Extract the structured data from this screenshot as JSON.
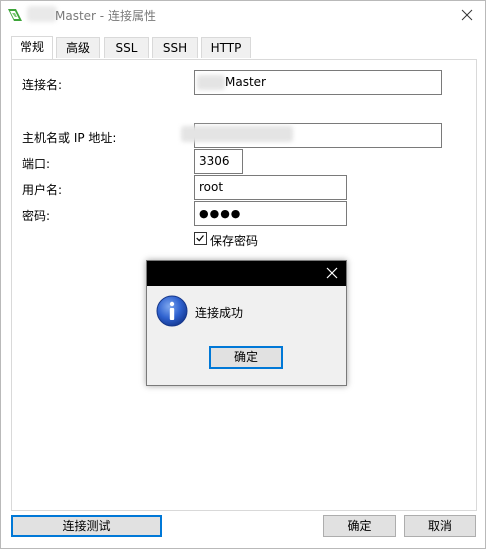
{
  "window": {
    "title": "Master - 连接属性",
    "close_glyph": "✕"
  },
  "tabs": [
    {
      "label": "常规",
      "active": true
    },
    {
      "label": "高级",
      "active": false
    },
    {
      "label": "SSL",
      "active": false
    },
    {
      "label": "SSH",
      "active": false
    },
    {
      "label": "HTTP",
      "active": false
    }
  ],
  "form": {
    "connection_name_label": "连接名:",
    "connection_name_value": "Master",
    "host_label": "主机名或 IP 地址:",
    "host_value": "",
    "port_label": "端口:",
    "port_value": "3306",
    "username_label": "用户名:",
    "username_value": "root",
    "password_label": "密码:",
    "password_value": "●●●●",
    "save_password_label": "保存密码",
    "save_password_checked": true
  },
  "footer": {
    "test_connection_label": "连接测试",
    "ok_label": "确定",
    "cancel_label": "取消"
  },
  "modal": {
    "message": "连接成功",
    "ok_label": "确定",
    "icon": "info-icon",
    "close_glyph": "✕"
  },
  "colors": {
    "accent": "#0078d7",
    "icon_green": "#3ea53a",
    "info_blue": "#1f4fb5"
  }
}
